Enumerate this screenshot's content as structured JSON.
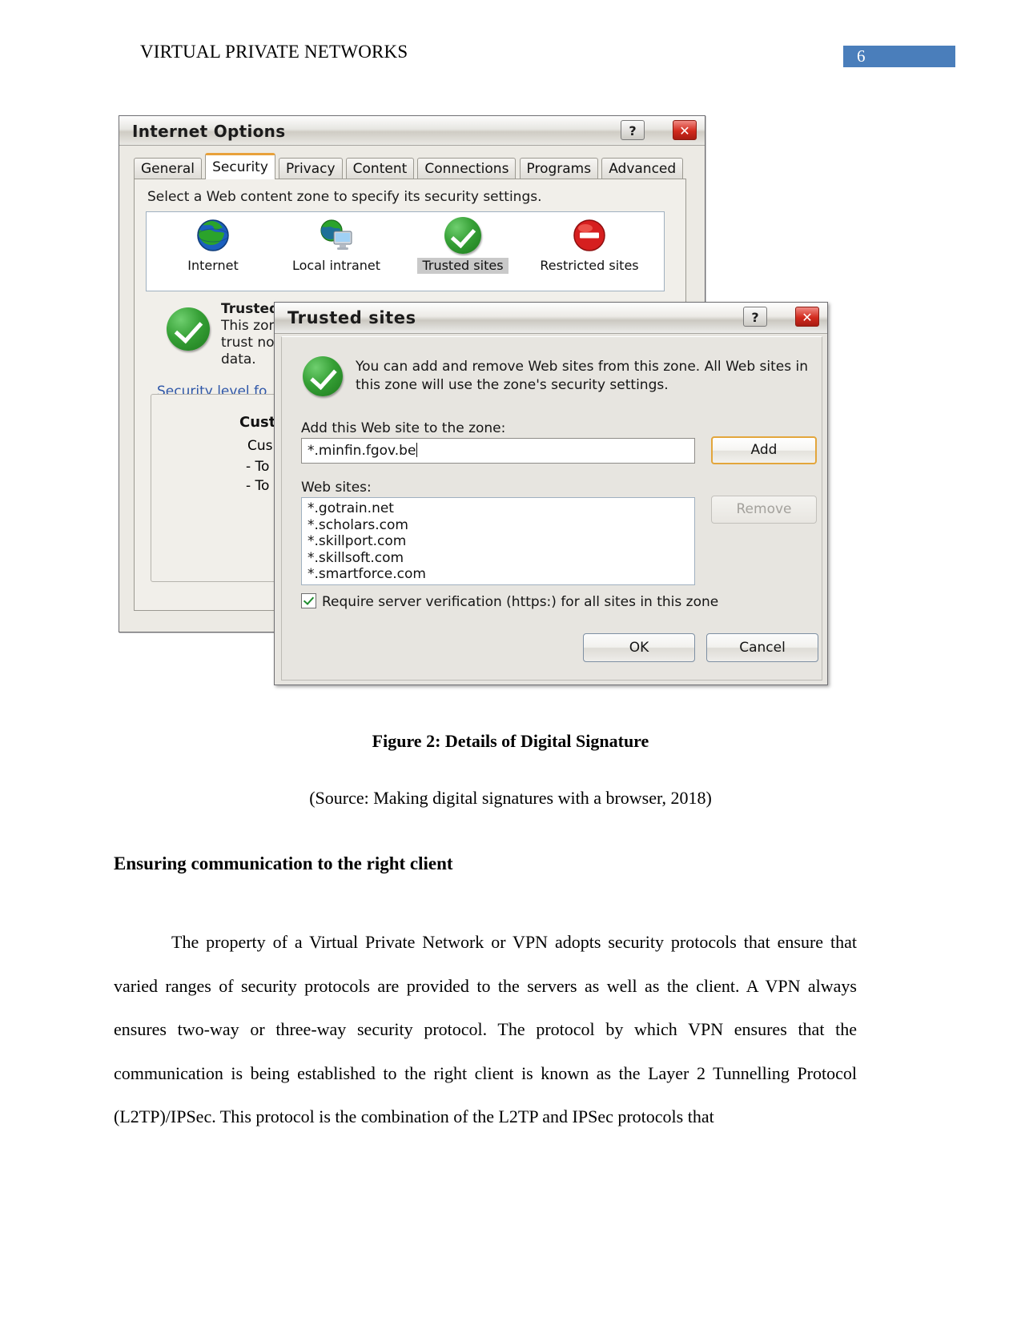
{
  "header": {
    "title": "VIRTUAL PRIVATE NETWORKS",
    "page_number": "6",
    "accent_color": "#4a7ebb"
  },
  "internet_options_dialog": {
    "title": "Internet Options",
    "help_button": "?",
    "close_button": "✕",
    "tabs": [
      {
        "label": "General",
        "active": false
      },
      {
        "label": "Security",
        "active": true
      },
      {
        "label": "Privacy",
        "active": false
      },
      {
        "label": "Content",
        "active": false
      },
      {
        "label": "Connections",
        "active": false
      },
      {
        "label": "Programs",
        "active": false
      },
      {
        "label": "Advanced",
        "active": false
      }
    ],
    "instruction": "Select a Web content zone to specify its security settings.",
    "zones": [
      {
        "label": "Internet",
        "icon": "globe-icon",
        "selected": false
      },
      {
        "label": "Local intranet",
        "icon": "globe-monitor-icon",
        "selected": false
      },
      {
        "label": "Trusted sites",
        "icon": "green-check-icon",
        "selected": true
      },
      {
        "label": "Restricted sites",
        "icon": "red-no-entry-icon",
        "selected": false
      }
    ],
    "zone_description": {
      "heading": "Trusted",
      "line1": "This zone",
      "line2": "trust not to",
      "line3": "data."
    },
    "security_level_link": "Security level fo",
    "security_level_group": {
      "title": "Custo",
      "line1": "Cus",
      "line2": "- To",
      "line3": "- To"
    }
  },
  "trusted_sites_dialog": {
    "title": "Trusted sites",
    "help_button": "?",
    "close_button": "✕",
    "intro": "You can add and remove Web sites from this zone. All Web sites in this zone will use the zone's security settings.",
    "add_label": "Add this Web site to the zone:",
    "add_input_value": "*.minfin.fgov.be",
    "add_button": "Add",
    "websites_label": "Web sites:",
    "websites": [
      "*.gotrain.net",
      "*.scholars.com",
      "*.skillport.com",
      "*.skillsoft.com",
      "*.smartforce.com"
    ],
    "remove_button": "Remove",
    "require_https_checkbox": {
      "label": "Require server verification (https:) for all sites in this zone",
      "checked": true
    },
    "ok_button": "OK",
    "cancel_button": "Cancel"
  },
  "figure": {
    "caption": "Figure 2: Details of Digital Signature",
    "source": "(Source: Making digital signatures with a browser, 2018)"
  },
  "content": {
    "section_heading": "Ensuring communication to the right client",
    "paragraph": "The property of a Virtual Private Network or VPN adopts security protocols that ensure that varied ranges of security protocols are provided to the servers as well as the client. A VPN always ensures two-way or three-way security protocol. The protocol by which VPN ensures that the communication is being established to the right client is known as the Layer 2 Tunnelling Protocol (L2TP)/IPSec. This protocol is the combination of the L2TP and IPSec protocols that"
  }
}
